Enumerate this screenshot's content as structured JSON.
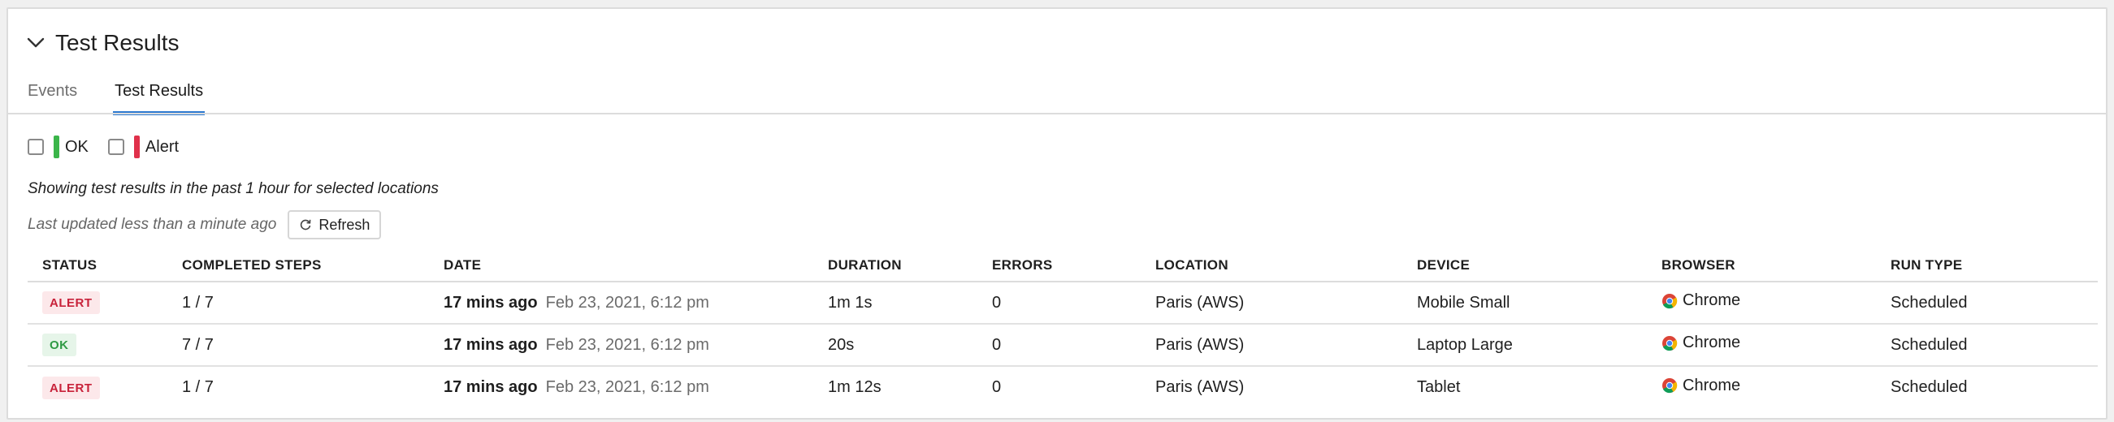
{
  "panel": {
    "title": "Test Results"
  },
  "tabs": [
    {
      "label": "Events",
      "active": false
    },
    {
      "label": "Test Results",
      "active": true
    }
  ],
  "filters": [
    {
      "label": "OK",
      "color": "#3bb54a",
      "checked": false
    },
    {
      "label": "Alert",
      "color": "#e0314b",
      "checked": false
    }
  ],
  "note": "Showing test results in the past 1 hour for selected locations",
  "updated": {
    "text": "Last updated less than a minute ago",
    "refresh_label": "Refresh"
  },
  "table": {
    "columns": [
      "STATUS",
      "COMPLETED STEPS",
      "DATE",
      "DURATION",
      "ERRORS",
      "LOCATION",
      "DEVICE",
      "BROWSER",
      "RUN TYPE"
    ],
    "rows": [
      {
        "status": "ALERT",
        "status_kind": "alert",
        "steps": "1 / 7",
        "ago": "17 mins ago",
        "date": "Feb 23, 2021, 6:12 pm",
        "duration": "1m 1s",
        "errors": "0",
        "location": "Paris (AWS)",
        "device": "Mobile Small",
        "browser": "Chrome",
        "browser_icon": "chrome-icon",
        "run_type": "Scheduled"
      },
      {
        "status": "OK",
        "status_kind": "ok",
        "steps": "7 / 7",
        "ago": "17 mins ago",
        "date": "Feb 23, 2021, 6:12 pm",
        "duration": "20s",
        "errors": "0",
        "location": "Paris (AWS)",
        "device": "Laptop Large",
        "browser": "Chrome",
        "browser_icon": "chrome-icon",
        "run_type": "Scheduled"
      },
      {
        "status": "ALERT",
        "status_kind": "alert",
        "steps": "1 / 7",
        "ago": "17 mins ago",
        "date": "Feb 23, 2021, 6:12 pm",
        "duration": "1m 12s",
        "errors": "0",
        "location": "Paris (AWS)",
        "device": "Tablet",
        "browser": "Chrome",
        "browser_icon": "chrome-icon",
        "run_type": "Scheduled"
      }
    ]
  },
  "colors": {
    "accent": "#2f7bd1",
    "alert": "#c8223a",
    "ok": "#2f9a44"
  }
}
